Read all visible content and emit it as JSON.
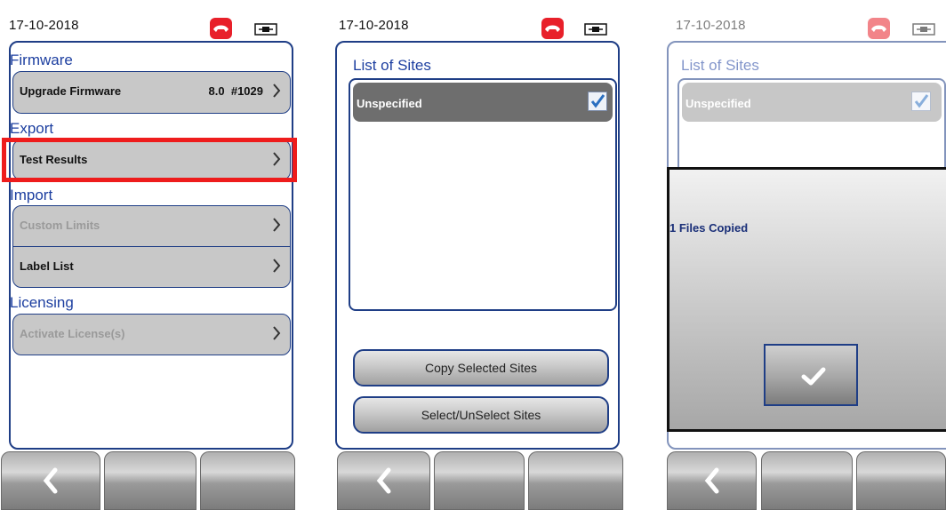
{
  "screen1": {
    "date": "17-10-2018",
    "sections": {
      "firmware": "Firmware",
      "export": "Export",
      "import": "Import",
      "licensing": "Licensing"
    },
    "rows": {
      "upgrade_firmware": {
        "label": "Upgrade Firmware",
        "value": "8.0  #1029"
      },
      "test_results": {
        "label": "Test Results"
      },
      "custom_limits": {
        "label": "Custom Limits",
        "state": "disabled"
      },
      "label_list": {
        "label": "Label List"
      },
      "activate_license": {
        "label": "Activate License(s)",
        "state": "disabled"
      }
    },
    "highlight_color": "#ee1c1c"
  },
  "screen2": {
    "date": "17-10-2018",
    "title": "List of Sites",
    "sites": [
      {
        "label": "Unspecified",
        "checked": true
      }
    ],
    "buttons": {
      "copy": "Copy Selected Sites",
      "select": "Select/UnSelect Sites"
    }
  },
  "screen3": {
    "date": "17-10-2018",
    "title": "List of Sites",
    "sites": [
      {
        "label": "Unspecified",
        "checked": true
      }
    ],
    "dialog": {
      "message": "1 Files Copied",
      "confirm_icon": "checkmark-icon"
    }
  },
  "icons": {
    "phone": "phone-hangup-icon",
    "battery": "power-plug-icon",
    "back": "chevron-left-icon",
    "row_arrow": "chevron-right-icon"
  },
  "colors": {
    "accent": "#1d3fa0",
    "border": "#1f3e86",
    "phone_red": "#e8202a"
  }
}
